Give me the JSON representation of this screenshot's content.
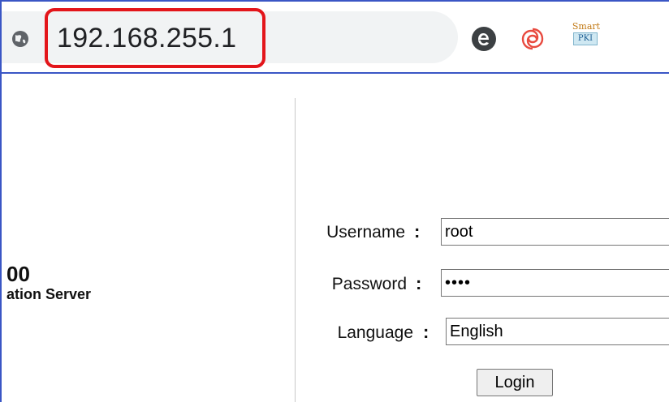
{
  "browser": {
    "url": "192.168.255.1",
    "extensions": [
      {
        "icon": "edge-e-icon"
      },
      {
        "icon": "swirl-logo-icon"
      },
      {
        "icon": "smart-pki-icon",
        "top_text": "Smart",
        "bottom_text": "PKI"
      }
    ],
    "highlight_color": "#e3151a"
  },
  "brand": {
    "model": "00",
    "subtitle": "ation Server"
  },
  "login_form": {
    "username_label": "Username",
    "username_value": "root",
    "password_label": "Password",
    "password_value": "••••",
    "language_label": "Language",
    "language_value": "English",
    "colon": ":",
    "login_button": "Login"
  },
  "colors": {
    "frame": "#3a56c5",
    "omnibox": "#f1f3f4"
  }
}
